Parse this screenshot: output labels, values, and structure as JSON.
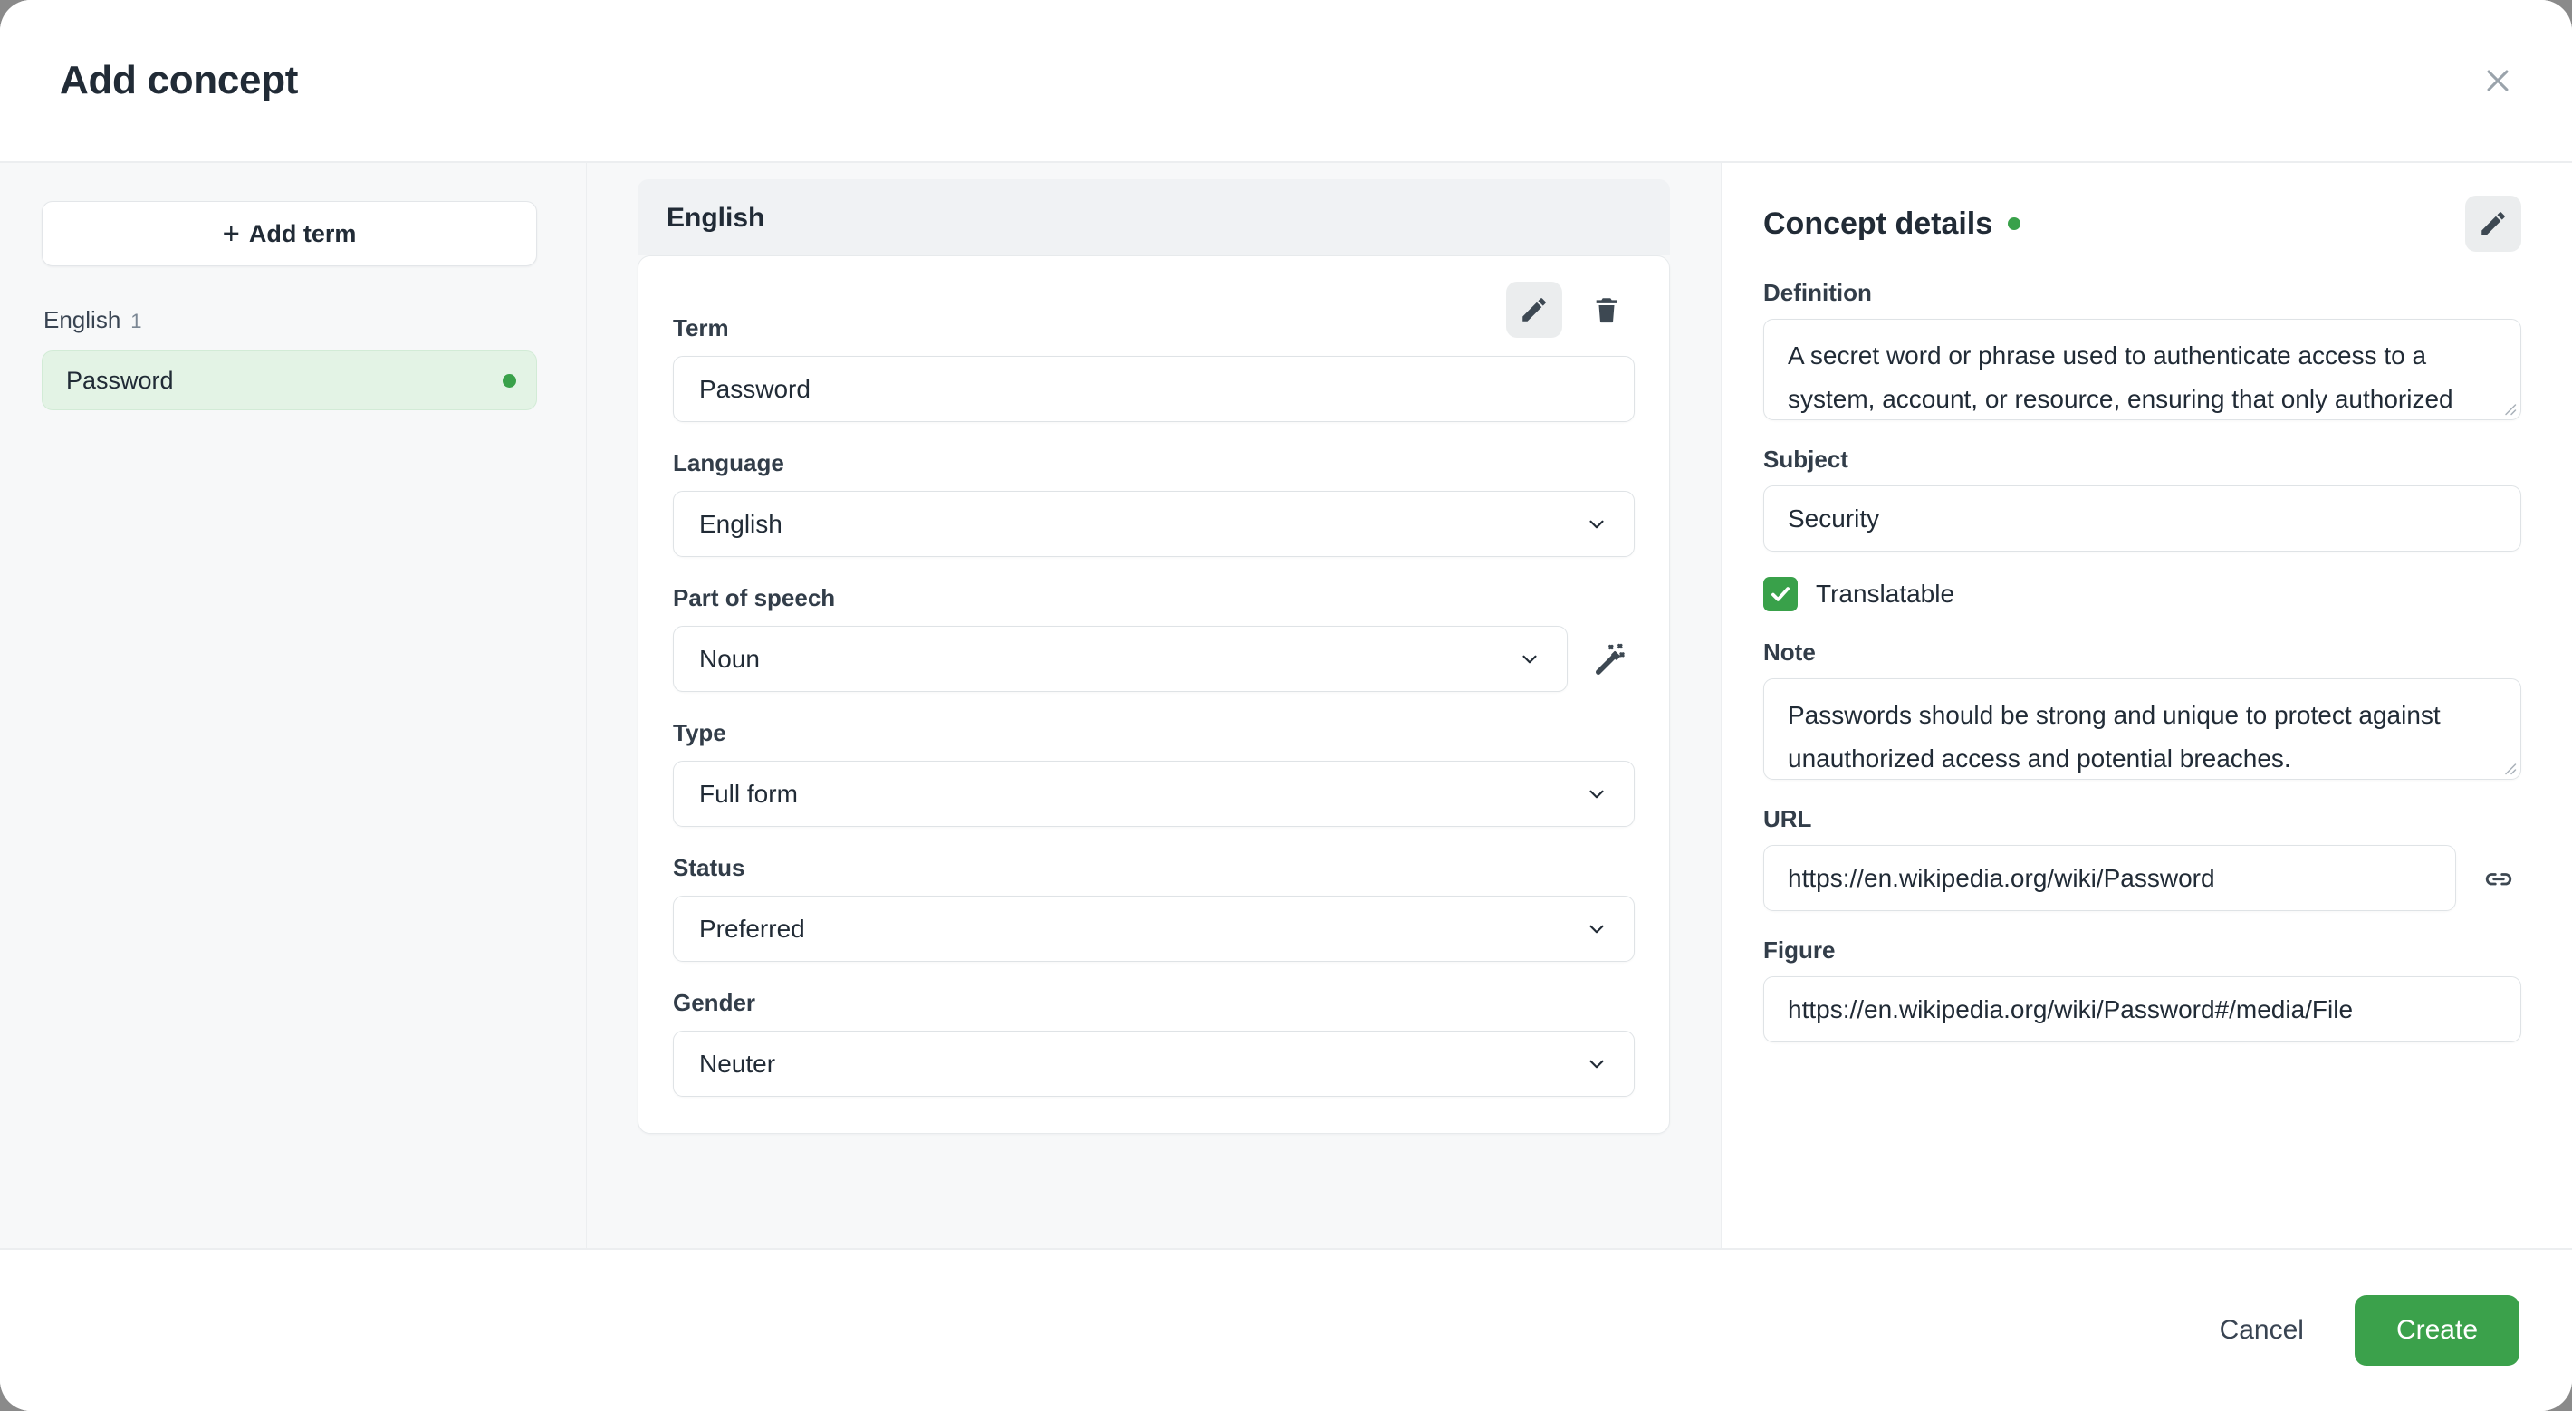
{
  "header": {
    "title": "Add concept",
    "close_icon": "close-icon"
  },
  "sidebar": {
    "add_term_label": "Add term",
    "add_term_plus": "+",
    "group_label": "English",
    "group_count": "1",
    "terms": [
      {
        "name": "Password",
        "status_color": "#39a14a"
      }
    ]
  },
  "center": {
    "language_header": "English",
    "actions": {
      "edit_icon": "pencil-icon",
      "delete_icon": "trash-icon"
    },
    "fields": [
      {
        "label": "Term",
        "value": "Password",
        "kind": "text"
      },
      {
        "label": "Language",
        "value": "English",
        "kind": "select"
      },
      {
        "label": "Part of speech",
        "value": "Noun",
        "kind": "select",
        "side_icon": "magic-wand-icon"
      },
      {
        "label": "Type",
        "value": "Full form",
        "kind": "select"
      },
      {
        "label": "Status",
        "value": "Preferred",
        "kind": "select"
      },
      {
        "label": "Gender",
        "value": "Neuter",
        "kind": "select"
      }
    ]
  },
  "details": {
    "title": "Concept details",
    "status_color": "#39a14a",
    "edit_icon": "pencil-icon",
    "definition_label": "Definition",
    "definition_value": "A secret word or phrase used to authenticate access to a system, account, or resource, ensuring that only authorized users can gain entry.",
    "subject_label": "Subject",
    "subject_value": "Security",
    "translatable_label": "Translatable",
    "translatable_checked": true,
    "note_label": "Note",
    "note_value": "Passwords should be strong and unique to protect against unauthorized access and potential breaches.",
    "url_label": "URL",
    "url_value": "https://en.wikipedia.org/wiki/Password",
    "url_icon": "link-icon",
    "figure_label": "Figure",
    "figure_value": "https://en.wikipedia.org/wiki/Password#/media/File"
  },
  "footer": {
    "cancel_label": "Cancel",
    "create_label": "Create",
    "create_color": "#3ba14b"
  }
}
